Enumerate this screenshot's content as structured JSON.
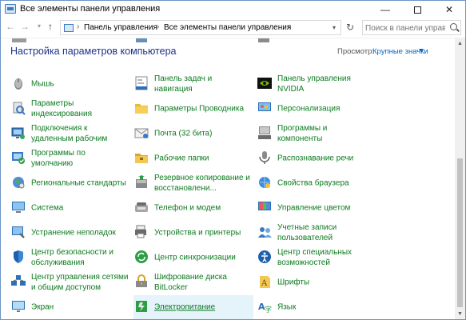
{
  "window": {
    "title": "Все элементы панели управления",
    "min_glyph": "—",
    "close_glyph": "✕"
  },
  "nav": {
    "back_glyph": "←",
    "forward_glyph": "→",
    "recent_glyph": "▾",
    "up_glyph": "↑",
    "breadcrumbs": [
      "Панель управления",
      "Все элементы панели управления"
    ],
    "sep_glyph": "›",
    "dropdown_glyph": "▾",
    "refresh_glyph": "↻",
    "search_placeholder": "Поиск в панели управления"
  },
  "header": {
    "title": "Настройка параметров компьютера",
    "view_by_label": "Просмотр:",
    "view_by_value": "Крупные значки"
  },
  "columns": [
    [
      {
        "label": "Мышь",
        "icon": "mouse-icon"
      },
      {
        "label": "Параметры\nиндексирования",
        "icon": "indexing-icon"
      },
      {
        "label": "Подключения к\nудаленным рабочим",
        "icon": "remote-desktop-icon"
      },
      {
        "label": "Программы по\nумолчанию",
        "icon": "default-programs-icon"
      },
      {
        "label": "Региональные стандарты",
        "icon": "region-icon"
      },
      {
        "label": "Система",
        "icon": "system-icon"
      },
      {
        "label": "Устранение неполадок",
        "icon": "troubleshooting-icon"
      },
      {
        "label": "Центр безопасности и\nобслуживания",
        "icon": "security-center-icon"
      },
      {
        "label": "Центр управления сетями\nи общим доступом",
        "icon": "network-icon"
      },
      {
        "label": "Экран",
        "icon": "display-icon"
      }
    ],
    [
      {
        "label": "Панель задач и\nнавигация",
        "icon": "taskbar-icon"
      },
      {
        "label": "Параметры Проводника",
        "icon": "explorer-options-icon"
      },
      {
        "label": "Почта (32 бита)",
        "icon": "mail-icon"
      },
      {
        "label": "Рабочие папки",
        "icon": "work-folders-icon"
      },
      {
        "label": "Резервное копирование и\nвосстановлени...",
        "icon": "backup-icon"
      },
      {
        "label": "Телефон и модем",
        "icon": "phone-modem-icon"
      },
      {
        "label": "Устройства и принтеры",
        "icon": "devices-printers-icon"
      },
      {
        "label": "Центр синхронизации",
        "icon": "sync-center-icon"
      },
      {
        "label": "Шифрование диска\nBitLocker",
        "icon": "bitlocker-icon"
      },
      {
        "label": "Электропитание",
        "icon": "power-options-icon"
      }
    ],
    [
      {
        "label": "Панель управления\nNVIDIA",
        "icon": "nvidia-icon"
      },
      {
        "label": "Персонализация",
        "icon": "personalization-icon"
      },
      {
        "label": "Программы и\nкомпоненты",
        "icon": "programs-features-icon"
      },
      {
        "label": "Распознавание речи",
        "icon": "speech-icon"
      },
      {
        "label": "Свойства браузера",
        "icon": "internet-options-icon"
      },
      {
        "label": "Управление цветом",
        "icon": "color-management-icon"
      },
      {
        "label": "Учетные записи\nпользователей",
        "icon": "user-accounts-icon"
      },
      {
        "label": "Центр специальных\nвозможностей",
        "icon": "ease-of-access-icon"
      },
      {
        "label": "Шрифты",
        "icon": "fonts-icon"
      },
      {
        "label": "Язык",
        "icon": "language-icon"
      }
    ]
  ],
  "hovered_item": "Электропитание",
  "colors": {
    "link": "#0c7a1f",
    "title": "#1e3287",
    "hover": "#e5f3fb",
    "accent": "#0066cc"
  }
}
